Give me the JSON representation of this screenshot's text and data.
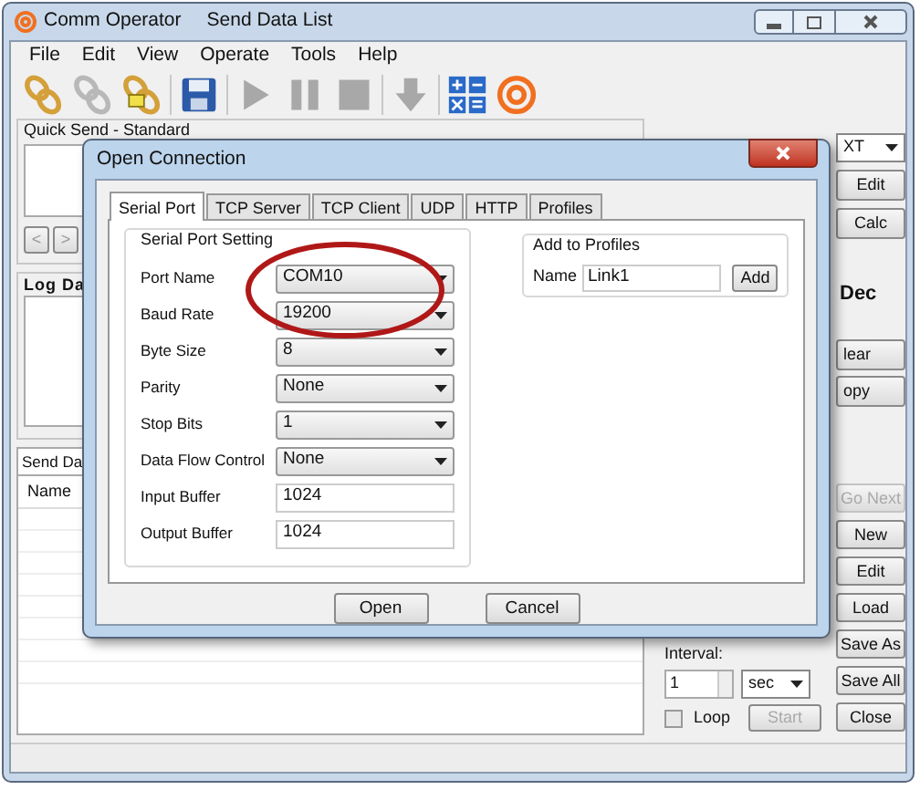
{
  "window": {
    "title": "Comm Operator",
    "subtitle": "Send Data List"
  },
  "menu": [
    "File",
    "Edit",
    "View",
    "Operate",
    "Tools",
    "Help"
  ],
  "toolbar": [
    {
      "kind": "chain",
      "disabled": false
    },
    {
      "kind": "chain",
      "disabled": true
    },
    {
      "kind": "chain-folder",
      "disabled": false
    },
    {
      "kind": "save",
      "disabled": false
    },
    {
      "kind": "play",
      "disabled": true
    },
    {
      "kind": "pause",
      "disabled": true
    },
    {
      "kind": "stop",
      "disabled": true
    },
    {
      "kind": "down",
      "disabled": true
    },
    {
      "kind": "calc",
      "disabled": false
    },
    {
      "kind": "logo",
      "disabled": false
    }
  ],
  "quick_send": {
    "title": "Quick Send - Standard",
    "nav": [
      "<",
      ">"
    ]
  },
  "log": {
    "title": "Log Da"
  },
  "send_data": {
    "tab": "Send Da",
    "columns": [
      "Name"
    ]
  },
  "right_top": {
    "format": "XT",
    "buttons": [
      "Edit",
      "Calc"
    ]
  },
  "right_middle": {
    "radio": "Dec",
    "buttons": [
      "lear",
      "opy"
    ]
  },
  "list_buttons": [
    {
      "label": "Go Next",
      "disabled": true
    },
    {
      "label": "New",
      "disabled": false
    },
    {
      "label": "Edit",
      "disabled": false
    },
    {
      "label": "Load",
      "disabled": false
    },
    {
      "label": "Save As",
      "disabled": false
    },
    {
      "label": "Save All",
      "disabled": false
    },
    {
      "label": "Close",
      "disabled": false
    }
  ],
  "interval": {
    "label": "Interval:",
    "value": "1",
    "unit": "sec",
    "loop": {
      "label": "Loop",
      "checked": false
    },
    "start": {
      "label": "Start",
      "disabled": true
    }
  },
  "dialog": {
    "title": "Open Connection",
    "tabs": [
      {
        "label": "Serial Port",
        "selected": true
      },
      {
        "label": "TCP Server",
        "selected": false
      },
      {
        "label": "TCP Client",
        "selected": false
      },
      {
        "label": "UDP",
        "selected": false
      },
      {
        "label": "HTTP",
        "selected": false
      },
      {
        "label": "Profiles",
        "selected": false
      }
    ],
    "group": "Serial Port Setting",
    "fields": [
      {
        "label": "Port Name",
        "kind": "select",
        "value": "COM10"
      },
      {
        "label": "Baud Rate",
        "kind": "select",
        "value": "19200"
      },
      {
        "label": "Byte Size",
        "kind": "select",
        "value": "8"
      },
      {
        "label": "Parity",
        "kind": "select",
        "value": "None"
      },
      {
        "label": "Stop Bits",
        "kind": "select",
        "value": "1"
      },
      {
        "label": "Data Flow Control",
        "kind": "select",
        "value": "None"
      },
      {
        "label": "Input Buffer",
        "kind": "input",
        "value": "1024"
      },
      {
        "label": "Output Buffer",
        "kind": "input",
        "value": "1024"
      }
    ],
    "profiles": {
      "title": "Add to Profiles",
      "label": "Name",
      "value": "Link1",
      "button": "Add"
    },
    "buttons": [
      "Open",
      "Cancel"
    ]
  }
}
